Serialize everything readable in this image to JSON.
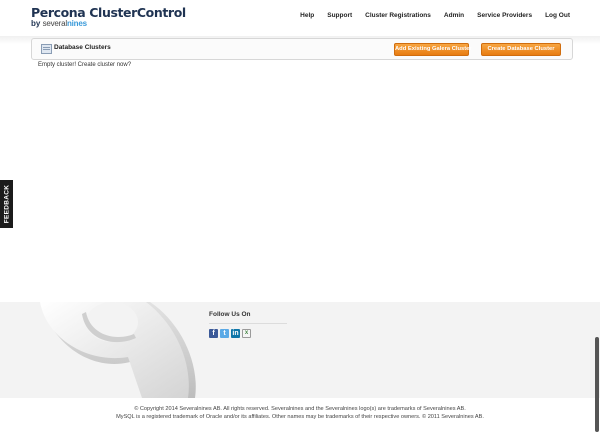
{
  "header": {
    "logo_title": "Percona ClusterControl",
    "logo_by": "by",
    "logo_brand_a": "several",
    "logo_brand_b": "nines",
    "nav": [
      "Help",
      "Support",
      "Cluster Registrations",
      "Admin",
      "Service Providers",
      "Log Out"
    ]
  },
  "panel": {
    "title": "Database Clusters",
    "add_button": "Add Existing Galera Cluster",
    "create_button": "Create Database Cluster",
    "empty_message": "Empty cluster! Create cluster now?"
  },
  "feedback": {
    "label": "FEEDBACK"
  },
  "footer": {
    "follow_title": "Follow Us On",
    "social_icons": [
      "facebook-icon",
      "twitter-icon",
      "linkedin-icon",
      "xing-icon"
    ],
    "copyright_line1": "© Copyright 2014 Severalnines AB. All rights reserved. Severalnines and the Severalnines logo(s) are trademarks of Severalnines AB.",
    "copyright_line2": "MySQL is a registered trademark of Oracle and/or its affiliates. Other names may be trademarks of their respective owners. © 2011 Severalnines AB."
  },
  "colors": {
    "brand_dark": "#1f3352",
    "brand_accent": "#3a9ad9",
    "button_orange": "#f39a2e"
  }
}
